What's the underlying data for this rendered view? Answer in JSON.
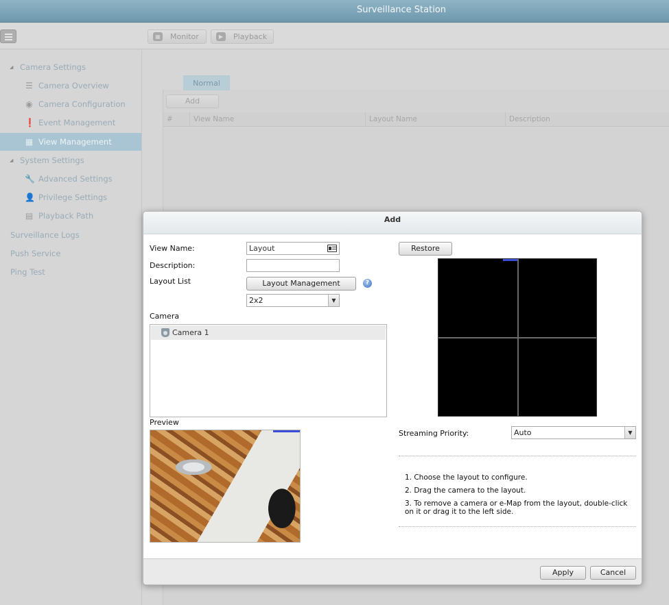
{
  "app": {
    "title": "Surveillance Station"
  },
  "toolbar": {
    "monitor_label": "Monitor",
    "playback_label": "Playback"
  },
  "sidebar": {
    "camera_settings": "Camera Settings",
    "camera_overview": "Camera Overview",
    "camera_configuration": "Camera Configuration",
    "event_management": "Event Management",
    "view_management": "View Management",
    "system_settings": "System Settings",
    "advanced_settings": "Advanced Settings",
    "privilege_settings": "Privilege Settings",
    "playback_path": "Playback Path",
    "surveillance_logs": "Surveillance Logs",
    "push_service": "Push Service",
    "ping_test": "Ping Test"
  },
  "main": {
    "tab_normal": "Normal",
    "add_label": "Add",
    "columns": [
      "#",
      "View Name",
      "Layout Name",
      "Description"
    ]
  },
  "dialog": {
    "title": "Add",
    "view_name_label": "View Name:",
    "view_name_value": "Layout",
    "description_label": "Description:",
    "description_value": "",
    "layout_list_label": "Layout List",
    "layout_management_label": "Layout Management",
    "layout_select_value": "2x2",
    "camera_label": "Camera",
    "cameras": [
      "Camera 1"
    ],
    "preview_label": "Preview",
    "restore_label": "Restore",
    "streaming_priority_label": "Streaming Priority:",
    "streaming_priority_value": "Auto",
    "instructions": [
      "1. Choose the layout to configure.",
      "2. Drag the camera to the layout.",
      "3. To remove a camera or e-Map from the layout, double-click on it or drag it to the left side."
    ],
    "apply_label": "Apply",
    "cancel_label": "Cancel"
  }
}
